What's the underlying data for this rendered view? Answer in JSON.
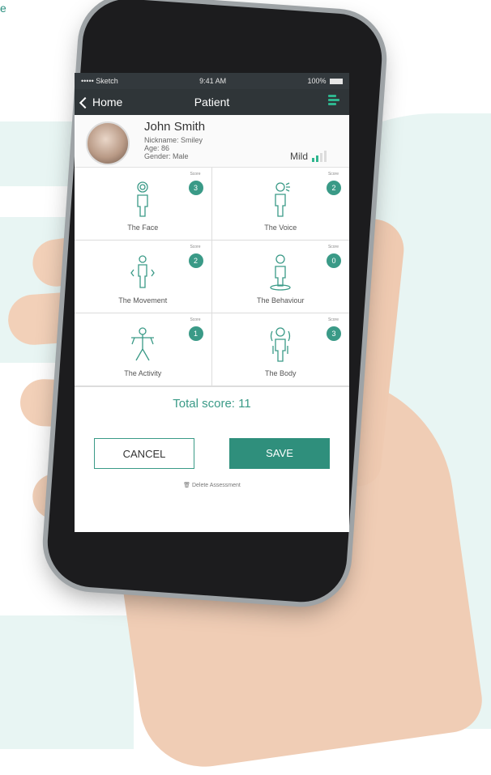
{
  "corner_text": "e",
  "status_bar": {
    "carrier": "••••• Sketch",
    "time": "9:41 AM",
    "battery": "100%"
  },
  "nav": {
    "back_label": "Home",
    "title": "Patient",
    "menu_icon": "list-icon"
  },
  "patient": {
    "name": "John Smith",
    "nickname": "Nickname: Smiley",
    "age": "Age: 86",
    "gender": "Gender: Male",
    "severity": "Mild",
    "severity_level": 2,
    "severity_max": 4
  },
  "categories": [
    {
      "label": "The Face",
      "score_label": "Score",
      "score": "3",
      "icon": "face-figure-icon"
    },
    {
      "label": "The Voice",
      "score_label": "Score",
      "score": "2",
      "icon": "voice-figure-icon"
    },
    {
      "label": "The Movement",
      "score_label": "Score",
      "score": "2",
      "icon": "movement-figure-icon"
    },
    {
      "label": "The Behaviour",
      "score_label": "Score",
      "score": "0",
      "icon": "behaviour-figure-icon"
    },
    {
      "label": "The Activity",
      "score_label": "Score",
      "score": "1",
      "icon": "activity-figure-icon"
    },
    {
      "label": "The Body",
      "score_label": "Score",
      "score": "3",
      "icon": "body-figure-icon"
    }
  ],
  "total": "Total score: 11",
  "buttons": {
    "cancel": "CANCEL",
    "save": "SAVE"
  },
  "delete_label": "Delete Assessment",
  "colors": {
    "accent": "#3a9a87",
    "nav_bg": "#2f3538",
    "status_bg": "#33393d",
    "background_shape": "#e8f5f3"
  }
}
